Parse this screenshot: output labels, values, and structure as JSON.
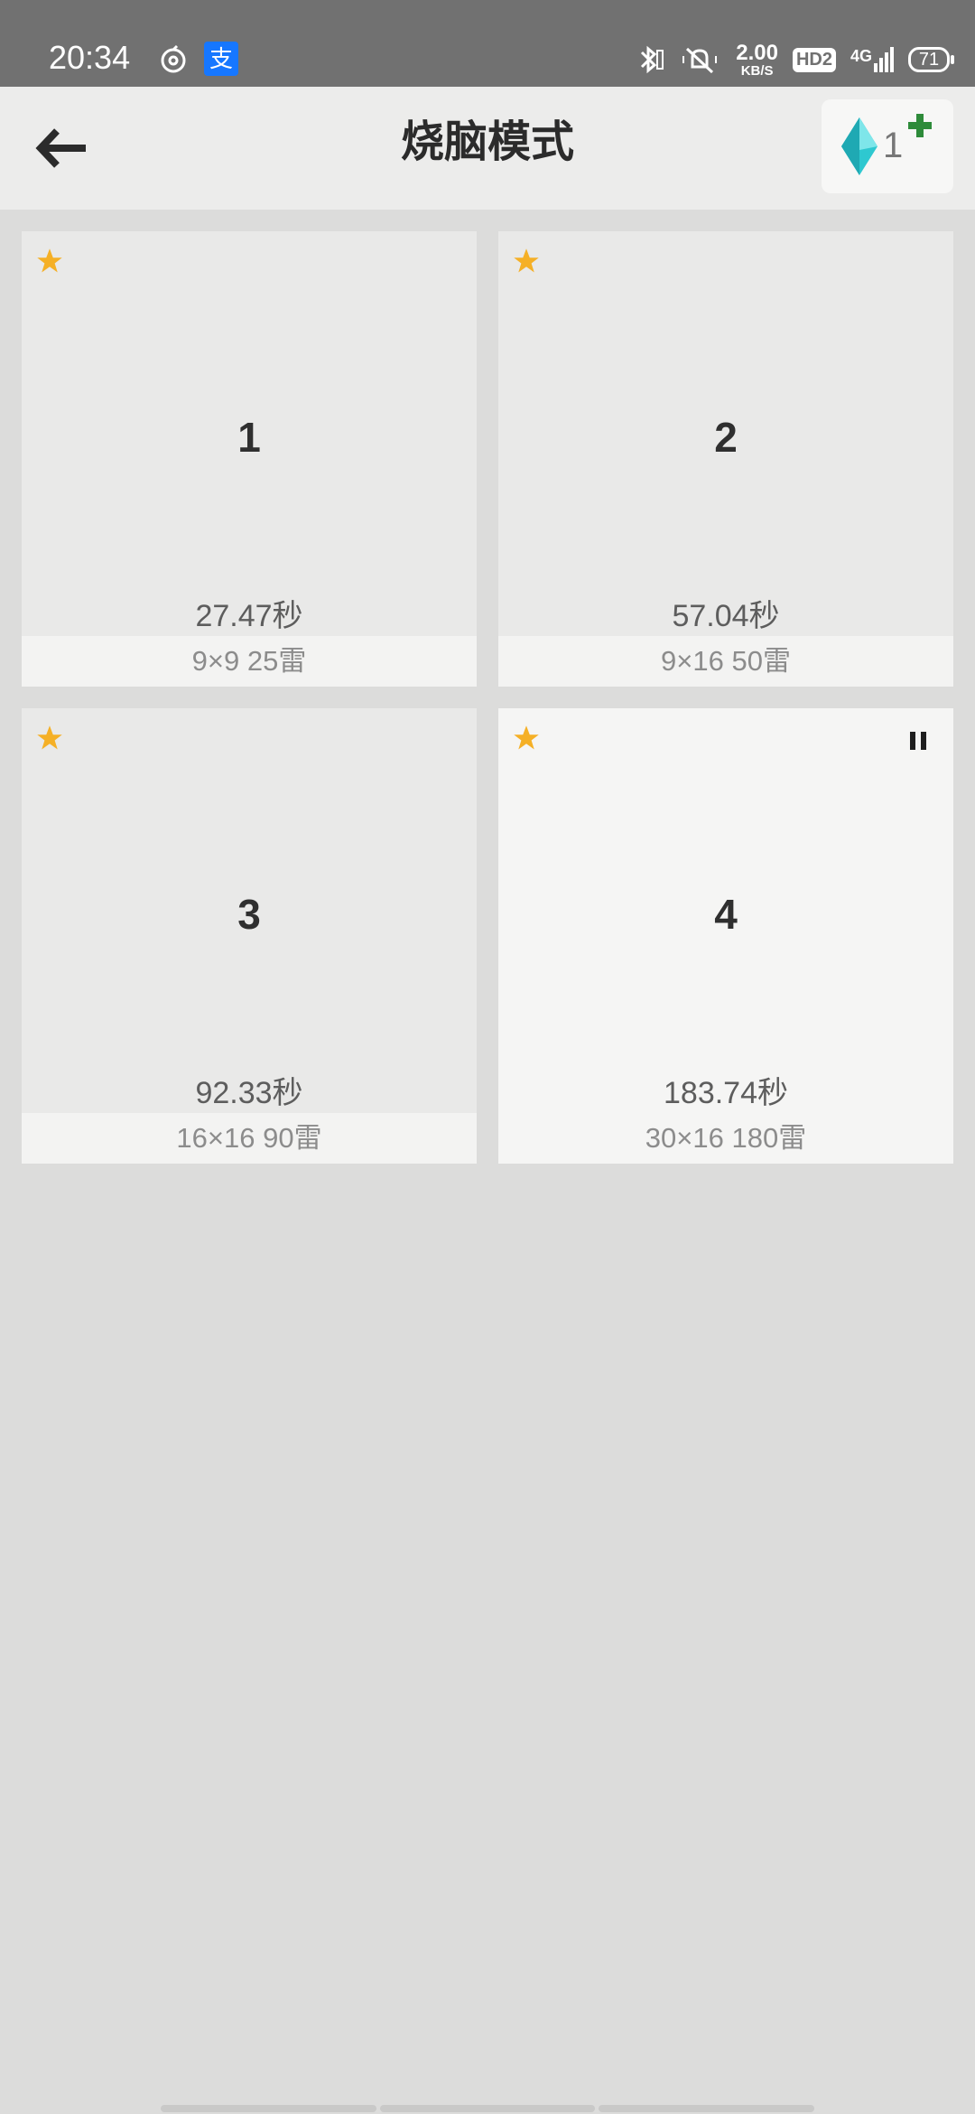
{
  "status_bar": {
    "time": "20:34",
    "icons_left": [
      "netease-music-icon",
      "alipay-icon"
    ],
    "alipay_glyph": "支",
    "net_speed_value": "2.00",
    "net_speed_unit": "KB/S",
    "hd_label": "HD2",
    "network_label": "4G",
    "battery": "71",
    "icons_right": [
      "bluetooth-icon",
      "silent-icon",
      "signal-icon",
      "battery-icon"
    ]
  },
  "header": {
    "title": "烧脑模式",
    "gem_count": "1",
    "gem_color": "#2ec8d0",
    "plus_color": "#2e8b3a"
  },
  "levels": [
    {
      "number": "1",
      "best_time": "27.47秒",
      "info": "9×9  25雷",
      "starred": true,
      "paused": false
    },
    {
      "number": "2",
      "best_time": "57.04秒",
      "info": "9×16  50雷",
      "starred": true,
      "paused": false
    },
    {
      "number": "3",
      "best_time": "92.33秒",
      "info": "16×16  90雷",
      "starred": true,
      "paused": false
    },
    {
      "number": "4",
      "best_time": "183.74秒",
      "info": "30×16  180雷",
      "starred": true,
      "paused": true
    }
  ],
  "colors": {
    "star": "#f5b026",
    "background": "#dcdcdb",
    "status_bar": "#717171"
  }
}
